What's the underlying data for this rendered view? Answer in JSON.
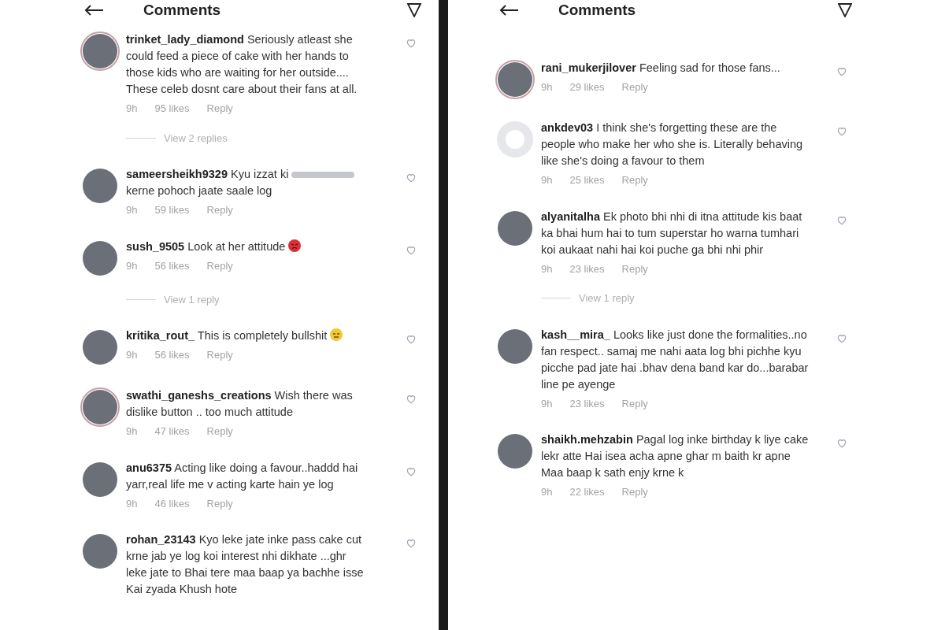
{
  "panels": [
    {
      "title": "Comments",
      "comments": [
        {
          "username": "trinket_lady_diamond",
          "text": "Seriously atleast she could feed a piece of cake with her hands to those kids who are waiting for her outside.... These celeb dosnt care about their fans at all.",
          "time": "9h",
          "likes": "95 likes",
          "reply": "Reply",
          "default_avatar": false,
          "story_ring": true,
          "angry_emoji": false,
          "neutral_emoji": false,
          "replies_link": "View 2 replies"
        },
        {
          "username": "sameersheikh9329",
          "text": "Kyu izzat ki",
          "censored": true,
          "text_after": "kerne pohoch jaate saale log",
          "time": "9h",
          "likes": "59 likes",
          "reply": "Reply",
          "default_avatar": false,
          "story_ring": false,
          "angry_emoji": false,
          "neutral_emoji": false
        },
        {
          "username": "sush_9505",
          "text": "Look at her attitude",
          "time": "9h",
          "likes": "56 likes",
          "reply": "Reply",
          "default_avatar": false,
          "story_ring": false,
          "angry_emoji": true,
          "neutral_emoji": false,
          "replies_link": "View 1 reply"
        },
        {
          "username": "kritika_rout_",
          "text": "This is completely bullshit",
          "time": "9h",
          "likes": "56 likes",
          "reply": "Reply",
          "default_avatar": false,
          "story_ring": false,
          "angry_emoji": false,
          "neutral_emoji": true
        },
        {
          "username": "swathi_ganeshs_creations",
          "text": "Wish there was dislike button .. too much attitude",
          "time": "9h",
          "likes": "47 likes",
          "reply": "Reply",
          "default_avatar": false,
          "story_ring": true,
          "angry_emoji": false,
          "neutral_emoji": false
        },
        {
          "username": "anu6375",
          "text": "Acting like doing a favour..haddd hai yarr,real life me v acting karte hain ye log",
          "time": "9h",
          "likes": "46 likes",
          "reply": "Reply",
          "default_avatar": false,
          "story_ring": false,
          "angry_emoji": false,
          "neutral_emoji": false
        },
        {
          "username": "rohan_23143",
          "text": "Kyo leke jate inke pass cake cut krne jab ye log koi interest nhi dikhate ...ghr leke jate to Bhai tere  maa baap ya bachhe isse Kai zyada Khush hote",
          "default_avatar": false,
          "story_ring": false,
          "angry_emoji": false,
          "neutral_emoji": false
        }
      ]
    },
    {
      "title": "Comments",
      "comments": [
        {
          "username": "rani_mukerjilover",
          "text": "Feeling sad for those fans...",
          "time": "9h",
          "likes": "29 likes",
          "reply": "Reply",
          "default_avatar": false,
          "story_ring": true,
          "angry_emoji": false,
          "neutral_emoji": false
        },
        {
          "username": "ankdev03",
          "text": "I think she's forgetting these are the people who make her who she is. Literally behaving like she's doing a favour to them",
          "time": "9h",
          "likes": "25 likes",
          "reply": "Reply",
          "default_avatar": true,
          "story_ring": false,
          "angry_emoji": false,
          "neutral_emoji": false
        },
        {
          "username": "alyanitalha",
          "text": "Ek photo bhi nhi di itna attitude kis baat ka bhai hum hai to tum superstar ho warna tumhari koi aukaat nahi hai koi puche ga bhi nhi phir",
          "time": "9h",
          "likes": "23 likes",
          "reply": "Reply",
          "default_avatar": false,
          "story_ring": false,
          "angry_emoji": false,
          "neutral_emoji": false,
          "replies_link": "View 1 reply"
        },
        {
          "username": "kash__mira_",
          "text": "Looks like just done the formalities..no fan respect.. samaj me nahi aata log bhi pichhe kyu picche pad jate hai .bhav dena band kar do...barabar line pe ayenge",
          "time": "9h",
          "likes": "23 likes",
          "reply": "Reply",
          "default_avatar": false,
          "story_ring": false,
          "angry_emoji": false,
          "neutral_emoji": false
        },
        {
          "username": "shaikh.mehzabin",
          "text": "Pagal log inke birthday k liye cake lekr atte Hai isea acha apne ghar m baith kr apne Maa baap k sath enjy krne k",
          "time": "9h",
          "likes": "22 likes",
          "reply": "Reply",
          "default_avatar": false,
          "story_ring": false,
          "angry_emoji": false,
          "neutral_emoji": false
        }
      ]
    }
  ]
}
